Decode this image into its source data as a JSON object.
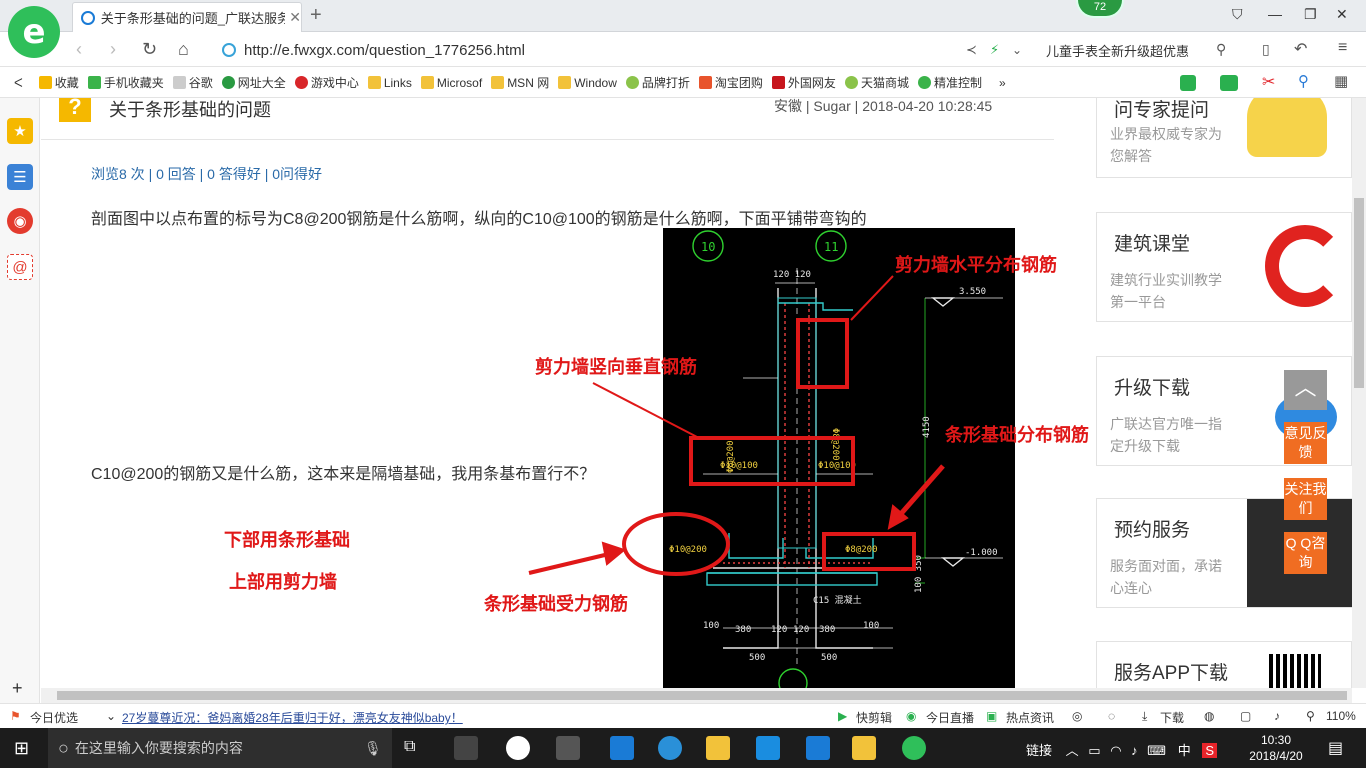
{
  "browser": {
    "tab_title": "关于条形基础的问题_广联达服务",
    "badge": "72",
    "url": "http://e.fwxgx.com/question_1776256.html",
    "search_hint": "儿童手表全新升级超优惠"
  },
  "bookmarks": [
    "收藏",
    "手机收藏夹",
    "谷歌",
    "网址大全",
    "游戏中心",
    "Links",
    "Microsof",
    "MSN 网",
    "Window",
    "品牌打折",
    "淘宝团购",
    "外国网友",
    "天猫商城",
    "精准控制"
  ],
  "question": {
    "title": "关于条形基础的问题",
    "meta": "安徽 | Sugar | 2018-04-20 10:28:45",
    "stats": "浏览8 次 | 0 回答 | 0 答得好 | 0问得好",
    "para1": "剖面图中以点布置的标号为C8@200钢筋是什么筋啊，纵向的C10@100的钢筋是什么筋啊，下面平铺带弯钩的",
    "para2": "C10@200的钢筋又是什么筋，这本来是隔墙基础，我用条基布置行不？"
  },
  "annotations": {
    "horiz_wall": "剪力墙水平分布钢筋",
    "vert_wall": "剪力墙竖向垂直钢筋",
    "strip_dist": "条形基础分布钢筋",
    "lower": "下部用条形基础",
    "upper": "上部用剪力墙",
    "strip_main": "条形基础受力钢筋"
  },
  "drawing": {
    "axis_a": "10",
    "axis_b": "11",
    "dim_top": "120 120",
    "elev_top": "3.550",
    "elev_low": "-1.000",
    "height": "4150",
    "rebar_v": "Φ10@100",
    "rebar_l": "Φ10@200",
    "rebar_r": "Φ8@200",
    "rebar_box": "Φ8@200",
    "conc": "C15 混凝土",
    "bottom_dims": [
      "100",
      "380",
      "120",
      "120",
      "380",
      "100"
    ],
    "bottom_dims2": [
      "500",
      "500"
    ],
    "side_dims": "100 350"
  },
  "sidebar": {
    "cards": [
      {
        "title": "问专家提问",
        "desc": "业界最权威专家为您解答"
      },
      {
        "title": "建筑课堂",
        "desc": "建筑行业实训教学第一平台"
      },
      {
        "title": "升级下载",
        "desc": "广联达官方唯一指定升级下载"
      },
      {
        "title": "预约服务",
        "desc": "服务面对面，承诺心连心"
      },
      {
        "title": "服务APP下载",
        "desc": ""
      }
    ],
    "float_buttons": [
      "意见反馈",
      "关注我们",
      "Q Q咨询"
    ]
  },
  "statusbar": {
    "left": "今日优选",
    "news": "27岁蔓尊近况：爸妈离婚28年后重归于好，漂亮女友神似baby！",
    "items": [
      "快剪辑",
      "今日直播",
      "热点资讯",
      "下载"
    ],
    "zoom": "110%"
  },
  "taskbar": {
    "search_placeholder": "在这里输入你要搜索的内容",
    "tray_text": "链接",
    "ime": "中",
    "time": "10:30",
    "date": "2018/4/20"
  }
}
